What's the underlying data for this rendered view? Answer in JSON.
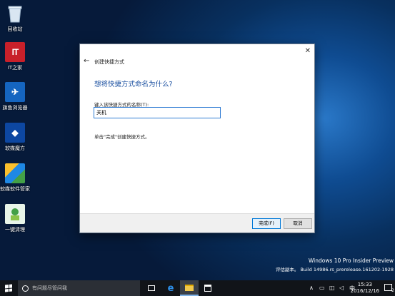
{
  "desktop": {
    "icons": [
      {
        "label": "回收站",
        "glyph": "♻"
      },
      {
        "label": "IT之家",
        "glyph": "IT"
      },
      {
        "label": "旗鱼浏览器",
        "glyph": "✈"
      },
      {
        "label": "软媒魔方",
        "glyph": "◆"
      },
      {
        "label": "软媒软件管家",
        "glyph": "■"
      },
      {
        "label": "一键清理",
        "glyph": "✿"
      }
    ]
  },
  "dialog": {
    "title": "创建快捷方式",
    "back_glyph": "←",
    "close_glyph": "✕",
    "heading": "想将快捷方式命名为什么?",
    "field_label": "键入该快捷方式的名称(T):",
    "field_value": "关机",
    "hint": "单击\"完成\"创建快捷方式。",
    "finish_label": "完成(F)",
    "cancel_label": "取消"
  },
  "watermark": {
    "line1": "Windows 10 Pro Insider Preview",
    "line2": "评估副本。 Build 14986.rs_prerelease.161202-1928"
  },
  "taskbar": {
    "search_placeholder": "有问题尽管问我",
    "tray_up_glyph": "∧",
    "tray_battery_glyph": "▭",
    "tray_net_glyph": "◫",
    "tray_vol_glyph": "◁",
    "tray_ime": "中",
    "time": "15:33",
    "date": "2016/12/16",
    "notifications_count": "2"
  },
  "colors": {
    "accent": "#0078d7",
    "heading": "#1a4fa0"
  }
}
